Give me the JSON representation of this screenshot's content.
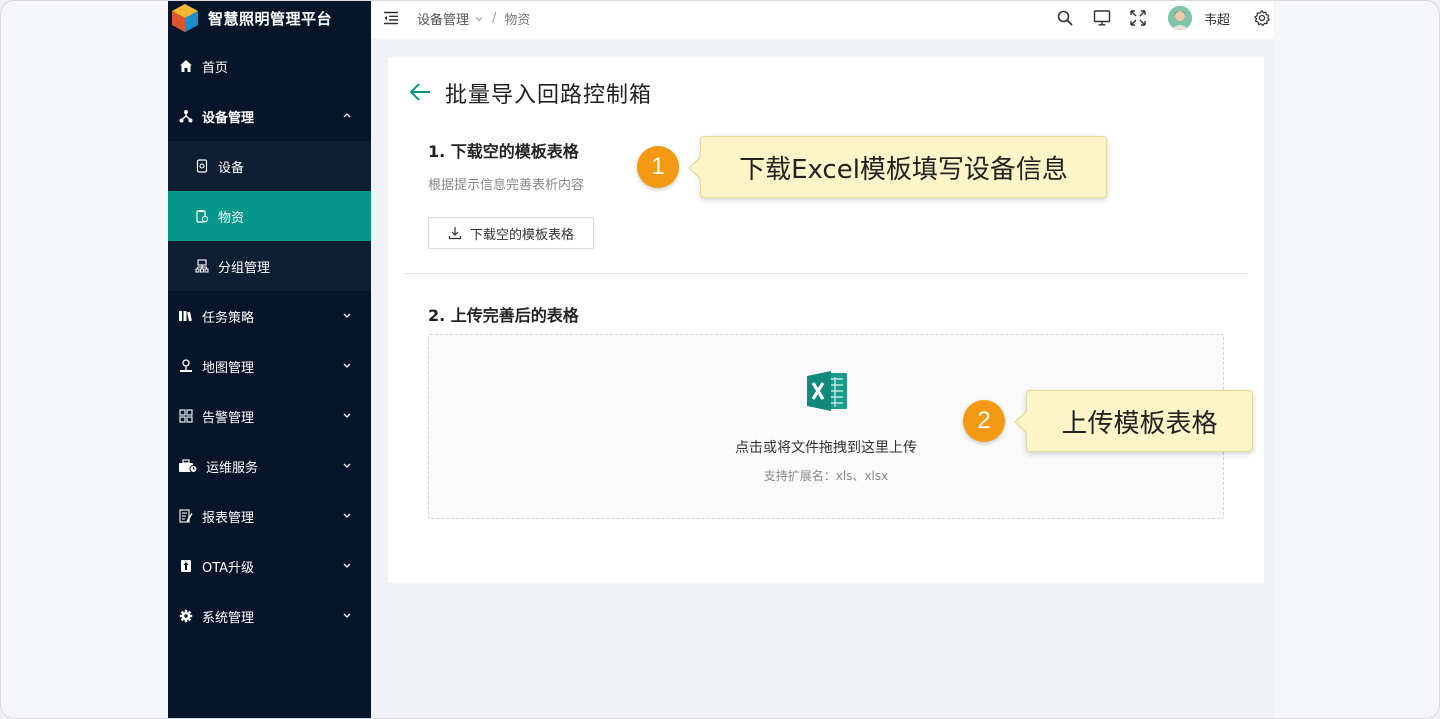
{
  "sidebar": {
    "brand_title": "智慧照明管理平台",
    "items": [
      {
        "label": "首页",
        "icon": "home-icon"
      },
      {
        "label": "设备管理",
        "icon": "network-icon"
      },
      {
        "label": "设备",
        "icon": "device-icon"
      },
      {
        "label": "物资",
        "icon": "material-icon"
      },
      {
        "label": "分组管理",
        "icon": "group-icon"
      },
      {
        "label": "任务策略",
        "icon": "strategy-icon"
      },
      {
        "label": "地图管理",
        "icon": "map-pin-icon"
      },
      {
        "label": "告警管理",
        "icon": "grid-icon"
      },
      {
        "label": "运维服务",
        "icon": "toolbox-icon"
      },
      {
        "label": "报表管理",
        "icon": "report-icon"
      },
      {
        "label": "OTA升级",
        "icon": "upgrade-icon"
      },
      {
        "label": "系统管理",
        "icon": "settings-icon"
      }
    ],
    "active_item": "物资",
    "accent_color": "#05978a",
    "background_color": "#061529"
  },
  "header": {
    "breadcrumb_parent": "设备管理",
    "breadcrumb_separator": "/",
    "breadcrumb_current": "物资",
    "user_name": "韦超"
  },
  "main": {
    "page_title": "批量导入回路控制箱",
    "step1_title": "1. 下载空的模板表格",
    "step1_desc": "根据提示信息完善表析内容",
    "download_button_label": "下载空的模板表格",
    "step2_title": "2. 上传完善后的表格",
    "dropzone_text": "点击或将文件拖拽到这里上传",
    "dropzone_hint": "支持扩展名：xls、xlsx"
  },
  "callouts": [
    {
      "number": "1",
      "text": "下载Excel模板填写设备信息"
    },
    {
      "number": "2",
      "text": "上传模板表格"
    }
  ]
}
